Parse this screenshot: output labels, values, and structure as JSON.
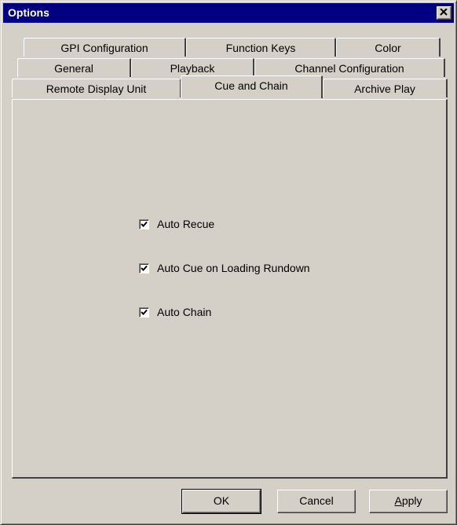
{
  "window": {
    "title": "Options"
  },
  "tabs": {
    "row1": [
      "GPI Configuration",
      "Function Keys",
      "Color"
    ],
    "row2": [
      "General",
      "Playback",
      "Channel Configuration"
    ],
    "row3": [
      "Remote Display Unit",
      "Cue and Chain",
      "Archive Play"
    ]
  },
  "active_tab": "Cue and Chain",
  "checkboxes": [
    {
      "label": "Auto Recue",
      "checked": true
    },
    {
      "label": "Auto Cue on Loading Rundown",
      "checked": true
    },
    {
      "label": "Auto Chain",
      "checked": true
    }
  ],
  "buttons": {
    "ok": "OK",
    "cancel": "Cancel",
    "apply_prefix": "A",
    "apply_rest": "pply"
  },
  "icons": {
    "close": "close-icon",
    "check": "checkmark-icon"
  }
}
